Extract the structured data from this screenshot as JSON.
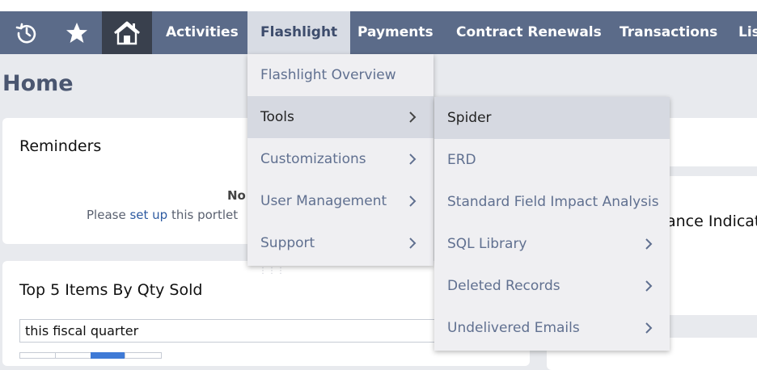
{
  "nav": {
    "items": [
      {
        "label": "Activities"
      },
      {
        "label": "Flashlight"
      },
      {
        "label": "Payments"
      },
      {
        "label": "Contract Renewals"
      },
      {
        "label": "Transactions"
      },
      {
        "label": "Lis"
      }
    ]
  },
  "page": {
    "title": "Home"
  },
  "reminders": {
    "title": "Reminders",
    "line1": "No",
    "line2_pre": "Please ",
    "line2_link": "set up",
    "line2_post": " this portlet"
  },
  "top5": {
    "title": "Top 5 Items By Qty Sold",
    "period": "this fiscal quarter"
  },
  "right_card": {
    "title_fragment": "ance Indicat"
  },
  "flashlight_menu": {
    "items": [
      {
        "label": "Flashlight Overview"
      },
      {
        "label": "Tools"
      },
      {
        "label": "Customizations"
      },
      {
        "label": "User Management"
      },
      {
        "label": "Support"
      }
    ]
  },
  "tools_menu": {
    "items": [
      {
        "label": "Spider"
      },
      {
        "label": "ERD"
      },
      {
        "label": "Standard Field Impact Analysis"
      },
      {
        "label": "SQL Library"
      },
      {
        "label": "Deleted Records"
      },
      {
        "label": "Undelivered Emails"
      }
    ]
  },
  "colors": {
    "navbar": "#5b6b89",
    "nav_active": "#d8dce4",
    "home_tile": "#39404d",
    "menu_bg": "#efeff2",
    "menu_selected": "#d6d9e1",
    "link": "#2d5aa0"
  }
}
